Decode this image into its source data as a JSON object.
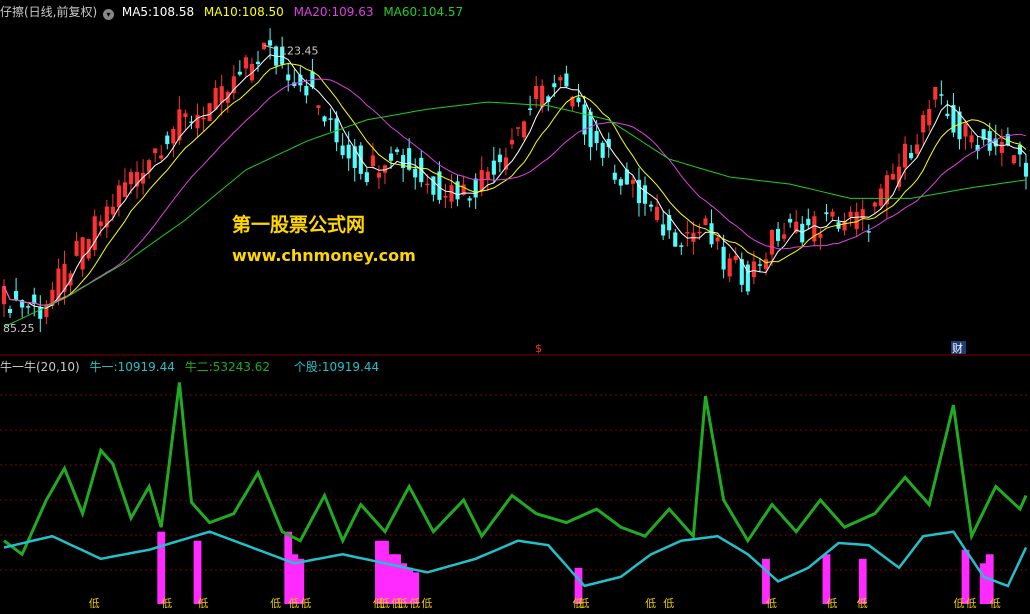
{
  "header": {
    "stock_name": "仔擦(日线,前复权)",
    "ma5": {
      "label": "MA5:",
      "value": "108.58",
      "color": "#FFFFFF"
    },
    "ma10": {
      "label": "MA10:",
      "value": "108.50",
      "color": "#FFFF00"
    },
    "ma20": {
      "label": "MA20:",
      "value": "109.63",
      "color": "#E040E0"
    },
    "ma60": {
      "label": "MA60:",
      "value": "104.57",
      "color": "#22CC22"
    }
  },
  "sub_header": {
    "indicator_name": "牛一牛(20,10)",
    "niu1": {
      "label": "牛一:",
      "value": "10919.44",
      "color": "#22C0C8"
    },
    "niu2": {
      "label": "牛二:",
      "value": "53243.62",
      "color": "#22AA22"
    },
    "gegu": {
      "label": "个股:",
      "value": "10919.44",
      "color": "#22C0C8"
    }
  },
  "watermark": {
    "title": "第一股票公式网",
    "url": "www.chnmoney.com"
  },
  "markers": {
    "dollar": "$",
    "cai": "财",
    "low": "低"
  },
  "colors": {
    "up": "#FF3232",
    "down": "#54FCFC",
    "grid": "#800000",
    "ma_main": "#FFFFFF"
  },
  "chart_data": [
    {
      "type": "candlestick",
      "title": "",
      "high_label": "123.45",
      "low_label": "85.25",
      "ylim": [
        83,
        127
      ],
      "series": [
        {
          "name": "MA5",
          "color": "#FFFFFF"
        },
        {
          "name": "MA10",
          "color": "#FFFF00"
        },
        {
          "name": "MA20",
          "color": "#E040E0"
        },
        {
          "name": "MA60",
          "color": "#22CC22"
        }
      ],
      "x_count": 170,
      "close_keypoints": [
        [
          0,
          88
        ],
        [
          6,
          86.5
        ],
        [
          12,
          94
        ],
        [
          20,
          104
        ],
        [
          28,
          112
        ],
        [
          36,
          116
        ],
        [
          43,
          123
        ],
        [
          47,
          120
        ],
        [
          50,
          118
        ],
        [
          55,
          110
        ],
        [
          60,
          106
        ],
        [
          64,
          109
        ],
        [
          70,
          104
        ],
        [
          77,
          103
        ],
        [
          82,
          108
        ],
        [
          88,
          116
        ],
        [
          92,
          118
        ],
        [
          97,
          111
        ],
        [
          103,
          104
        ],
        [
          110,
          97
        ],
        [
          116,
          97.5
        ],
        [
          119,
          93
        ],
        [
          123,
          91
        ],
        [
          128,
          97
        ],
        [
          133,
          98
        ],
        [
          138,
          99
        ],
        [
          143,
          99
        ],
        [
          149,
          108
        ],
        [
          154,
          116
        ],
        [
          158,
          111
        ],
        [
          163,
          110
        ],
        [
          169,
          107
        ]
      ],
      "ma60_keypoints": [
        [
          0,
          84
        ],
        [
          10,
          88
        ],
        [
          20,
          93
        ],
        [
          30,
          99
        ],
        [
          40,
          106
        ],
        [
          50,
          110
        ],
        [
          60,
          113
        ],
        [
          70,
          114.5
        ],
        [
          80,
          115.5
        ],
        [
          90,
          115
        ],
        [
          100,
          113
        ],
        [
          110,
          107.5
        ],
        [
          120,
          105
        ],
        [
          130,
          104
        ],
        [
          140,
          102
        ],
        [
          150,
          102
        ],
        [
          160,
          103.5
        ],
        [
          169,
          104.6
        ]
      ]
    },
    {
      "type": "line",
      "title": "",
      "ylim": [
        0,
        100
      ],
      "series": [
        {
          "name": "牛一",
          "color": "#22C0C8"
        },
        {
          "name": "牛二",
          "color": "#22AA22"
        }
      ],
      "niu1_keypoints": [
        [
          0,
          25
        ],
        [
          8,
          30
        ],
        [
          16,
          20
        ],
        [
          24,
          24
        ],
        [
          34,
          32
        ],
        [
          44,
          22
        ],
        [
          48,
          18
        ],
        [
          56,
          22
        ],
        [
          63,
          18
        ],
        [
          70,
          14
        ],
        [
          78,
          20
        ],
        [
          85,
          28
        ],
        [
          90,
          26
        ],
        [
          96,
          8
        ],
        [
          102,
          12
        ],
        [
          107,
          22
        ],
        [
          112,
          28
        ],
        [
          118,
          30
        ],
        [
          123,
          22
        ],
        [
          128,
          10
        ],
        [
          133,
          16
        ],
        [
          138,
          27
        ],
        [
          143,
          26
        ],
        [
          148,
          16
        ],
        [
          152,
          30
        ],
        [
          157,
          32
        ],
        [
          162,
          12
        ],
        [
          166,
          8
        ],
        [
          169,
          25
        ]
      ],
      "niu2_keypoints": [
        [
          0,
          28
        ],
        [
          3,
          22
        ],
        [
          7,
          46
        ],
        [
          10,
          60
        ],
        [
          13,
          40
        ],
        [
          16,
          68
        ],
        [
          18,
          62
        ],
        [
          21,
          38
        ],
        [
          24,
          52
        ],
        [
          26,
          34
        ],
        [
          29,
          98
        ],
        [
          31,
          45
        ],
        [
          34,
          36
        ],
        [
          38,
          40
        ],
        [
          42,
          58
        ],
        [
          46,
          32
        ],
        [
          49,
          28
        ],
        [
          53,
          48
        ],
        [
          56,
          28
        ],
        [
          59,
          44
        ],
        [
          63,
          32
        ],
        [
          67,
          52
        ],
        [
          71,
          32
        ],
        [
          76,
          46
        ],
        [
          79,
          30
        ],
        [
          84,
          48
        ],
        [
          88,
          40
        ],
        [
          93,
          36
        ],
        [
          98,
          42
        ],
        [
          102,
          34
        ],
        [
          106,
          30
        ],
        [
          110,
          42
        ],
        [
          114,
          30
        ],
        [
          116,
          92
        ],
        [
          119,
          46
        ],
        [
          123,
          28
        ],
        [
          127,
          44
        ],
        [
          131,
          32
        ],
        [
          135,
          46
        ],
        [
          139,
          34
        ],
        [
          144,
          40
        ],
        [
          149,
          56
        ],
        [
          153,
          44
        ],
        [
          157,
          88
        ],
        [
          160,
          30
        ],
        [
          164,
          52
        ],
        [
          168,
          42
        ],
        [
          169,
          48
        ]
      ],
      "bars": [
        [
          26,
          32
        ],
        [
          32,
          28
        ],
        [
          47,
          32
        ],
        [
          48,
          22
        ],
        [
          49,
          20
        ],
        [
          62,
          28
        ],
        [
          63,
          28
        ],
        [
          64,
          22
        ],
        [
          65,
          22
        ],
        [
          66,
          18
        ],
        [
          67,
          16
        ],
        [
          68,
          14
        ],
        [
          95,
          16
        ],
        [
          126,
          20
        ],
        [
          136,
          22
        ],
        [
          142,
          20
        ],
        [
          159,
          24
        ],
        [
          162,
          18
        ],
        [
          163,
          22
        ]
      ],
      "low_positions": [
        15,
        27,
        33,
        45,
        48,
        50,
        62,
        63,
        65,
        66,
        68,
        70,
        95,
        96,
        107,
        110,
        127,
        137,
        142,
        158,
        160,
        164
      ]
    }
  ]
}
